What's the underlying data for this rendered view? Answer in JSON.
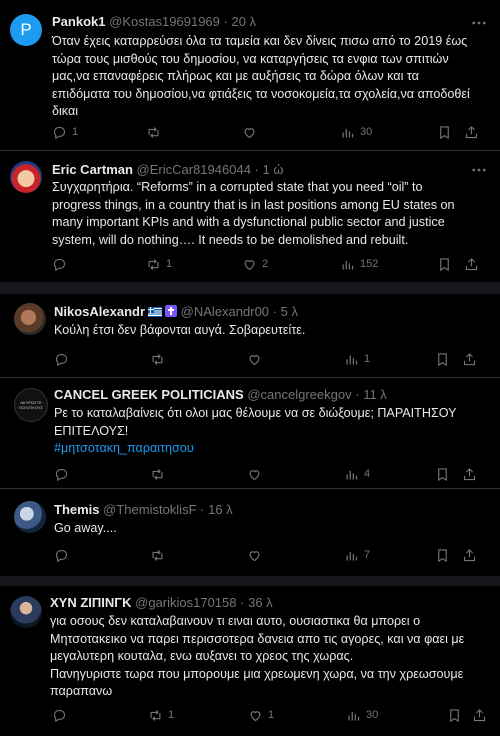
{
  "tweets": [
    {
      "name": "Pankok1",
      "handle": "@Kostas19691969",
      "time": "20 λ",
      "lines": [
        "Όταν έχεις καταρρεύσει όλα τα ταμεία και δεν δίνεις πισω από το 2019 έως",
        "τώρα τους μισθούς του δημοσίου, να καταργήσεις τα ενφια των σπιτιών",
        "μας,να επαναφέρεις πλήρως και με αυξήσεις τα δώρα όλων και τα",
        "επιδόματα του δημοσίου,να φτιάξεις τα νοσοκομεία,τα σχολεία,να αποδοθεί",
        "δικαι"
      ],
      "replies": "1",
      "retweets": "",
      "likes": "",
      "views": "30"
    },
    {
      "name": "Eric Cartman",
      "handle": "@EricCar81946044",
      "time": "1 ώ",
      "lines": [
        "Συγχαρητήρια. “Reforms” in a corrupted state that you need “oil” to",
        "progress things, in a country that is in last positions among EU states on",
        "many important KPIs and with a dysfunctional public sector and justice",
        "system, will do nothing…. It needs to be demolished and rebuilt."
      ],
      "replies": "",
      "retweets": "1",
      "likes": "2",
      "views": "152"
    },
    {
      "name": "NikosAlexandr",
      "handle": "@NAlexandr00",
      "time": "5 λ",
      "lines": [
        "Κούλη έτσι δεν βάφονται αυγά. Σοβαρευτείτε."
      ],
      "replies": "",
      "retweets": "",
      "likes": "",
      "views": "1"
    },
    {
      "name": "CANCEL GREEK POLITICIANS",
      "handle": "@cancelgreekgov",
      "time": "11 λ",
      "avatar_text": "ΑΚΥΡΩΣΤΕ ΠΟΛΙΤΙΚΟΥΣ",
      "lines": [
        "Ρε το καταλαβαίνεις ότι ολοι μας θέλουμε να σε διώξουμε; ΠΑΡΑΙΤΗΣΟΥ",
        "ΕΠΙΤΕΛΟΥΣ!"
      ],
      "hashtag": "#μητσοτακη_παραιτησου",
      "replies": "",
      "retweets": "",
      "likes": "",
      "views": "4"
    },
    {
      "name": "Themis",
      "handle": "@ThemistoklisF",
      "time": "16 λ",
      "lines": [
        "Go away...."
      ],
      "replies": "",
      "retweets": "",
      "likes": "",
      "views": "7"
    },
    {
      "name": "ΧΥΝ ΖΙΠΙΝΓΚ",
      "handle": "@garikios170158",
      "time": "36 λ",
      "lines": [
        "για οσους δεν καταλαβαινουν τι ειναι αυτο, ουσιαστικα θα μπορει ο",
        "Μητσοτακεικο να παρει περισσοτερα δανεια απο τις αγορες, και να φαει με",
        "μεγαλυτερη κουταλα, ενω αυξανει το χρεος της χωρας.",
        "Πανηγυριστε τωρα που μπορουμε μια χρεωμενη χωρα, να την χρεωσουμε",
        "παραπανω"
      ],
      "replies": "",
      "retweets": "1",
      "likes": "1",
      "views": "30"
    }
  ],
  "colors": {
    "background": "#000000",
    "text": "#e7e9ea",
    "muted": "#71767b",
    "link": "#1d9bf0",
    "divider": "#2f3336"
  },
  "icons": [
    "reply-icon",
    "retweet-icon",
    "like-icon",
    "views-icon",
    "bookmark-icon",
    "share-icon",
    "more-icon"
  ]
}
